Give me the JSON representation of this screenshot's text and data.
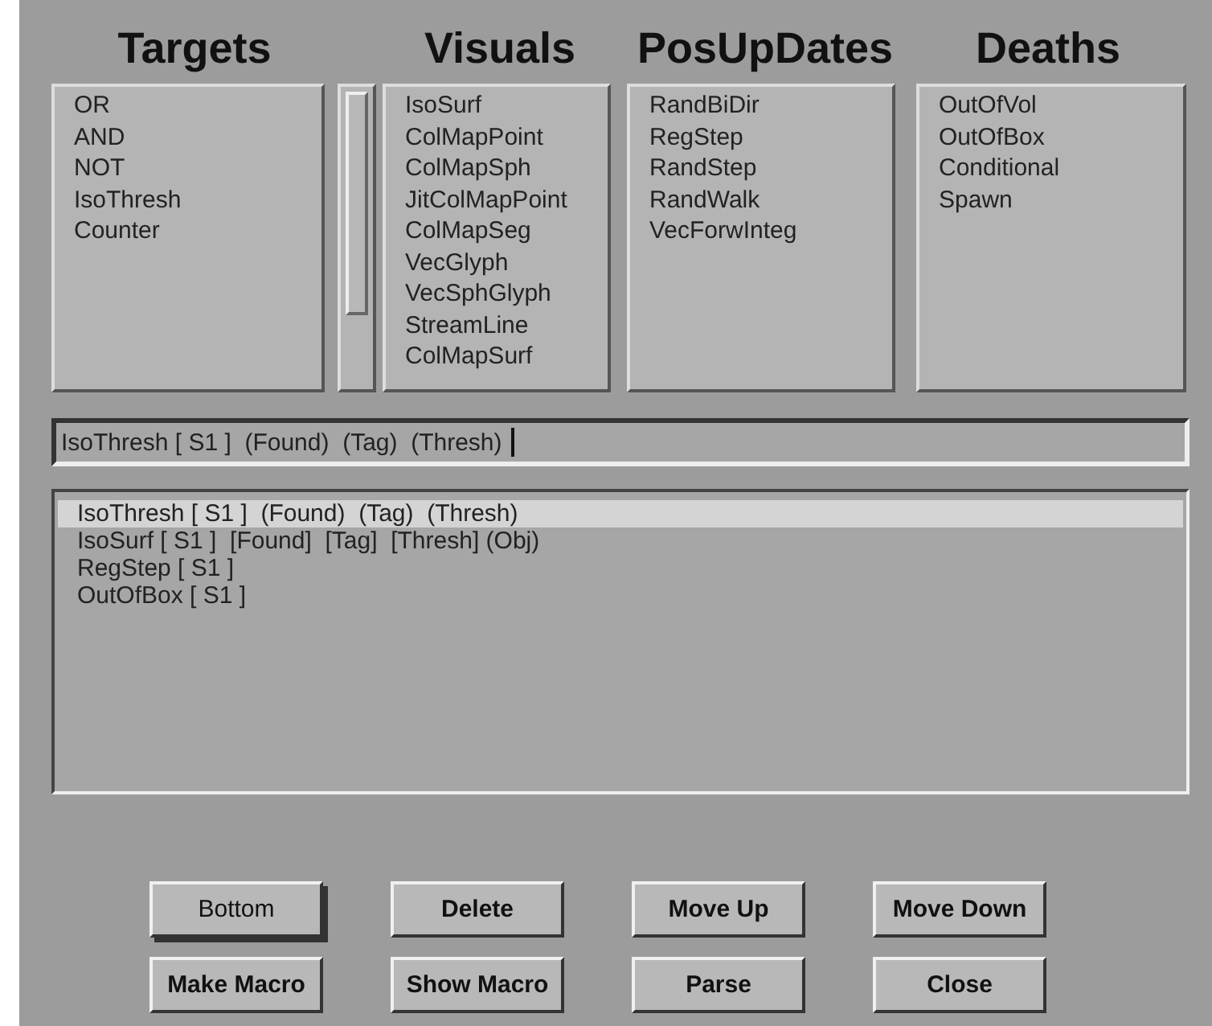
{
  "columns": [
    {
      "heading": "Targets",
      "items": [
        "OR",
        "AND",
        "NOT",
        "IsoThresh",
        "Counter"
      ]
    },
    {
      "heading": "Visuals",
      "items": [
        "IsoSurf",
        "ColMapPoint",
        "ColMapSph",
        "JitColMapPoint",
        "ColMapSeg",
        "VecGlyph",
        "VecSphGlyph",
        "StreamLine",
        "ColMapSurf"
      ]
    },
    {
      "heading": "PosUpDates",
      "items": [
        "RandBiDir",
        "RegStep",
        "RandStep",
        "RandWalk",
        "VecForwInteg"
      ]
    },
    {
      "heading": "Deaths",
      "items": [
        "OutOfVol",
        "OutOfBox",
        "Conditional",
        "Spawn"
      ]
    }
  ],
  "command": {
    "value": "IsoThresh [ S1 ]  (Found)  (Tag)  (Thresh)"
  },
  "program": [
    {
      "text": "IsoThresh [ S1 ]  (Found)  (Tag)  (Thresh)",
      "selected": true
    },
    {
      "text": "IsoSurf [ S1 ]  [Found]  [Tag]  [Thresh] (Obj)",
      "selected": false
    },
    {
      "text": "RegStep [ S1 ]",
      "selected": false
    },
    {
      "text": "OutOfBox [ S1 ]",
      "selected": false
    }
  ],
  "buttons": [
    {
      "label": "Bottom",
      "kind": "toggle"
    },
    {
      "label": "Delete",
      "kind": "push"
    },
    {
      "label": "Move Up",
      "kind": "push"
    },
    {
      "label": "Move Down",
      "kind": "push"
    },
    {
      "label": "Make Macro",
      "kind": "push"
    },
    {
      "label": "Show Macro",
      "kind": "push"
    },
    {
      "label": "Parse",
      "kind": "push"
    },
    {
      "label": "Close",
      "kind": "push"
    }
  ]
}
